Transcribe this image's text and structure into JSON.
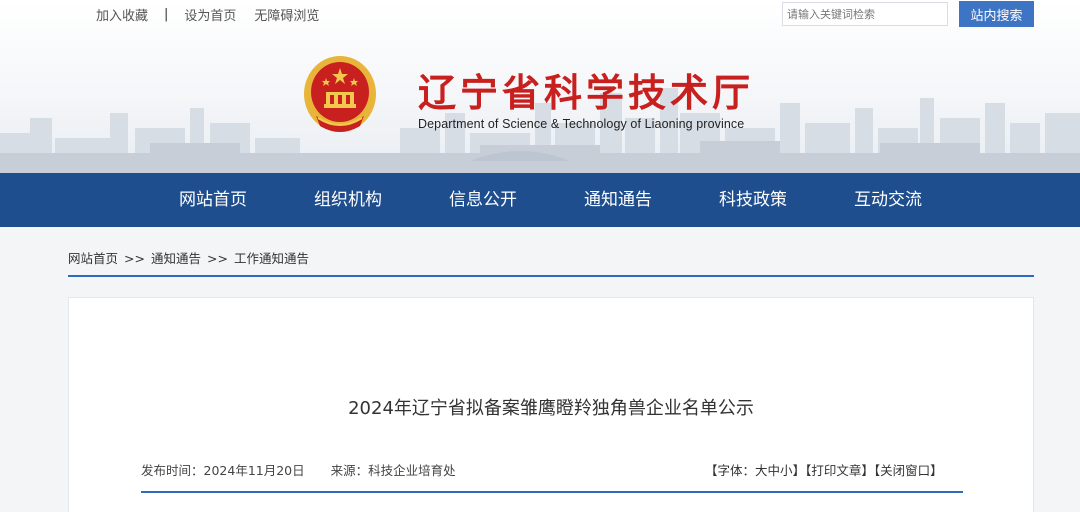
{
  "toolbar": {
    "add_favorite": "加入收藏",
    "separator": "|",
    "set_homepage": "设为首页",
    "accessibility": "无障碍浏览"
  },
  "search": {
    "placeholder": "请输入关键词检索",
    "button_label": "站内搜索"
  },
  "header": {
    "title": "辽宁省科学技术厅",
    "subtitle": "Department of Science & Technology of Liaoning province"
  },
  "nav": {
    "items": [
      {
        "label": "网站首页"
      },
      {
        "label": "组织机构"
      },
      {
        "label": "信息公开"
      },
      {
        "label": "通知通告"
      },
      {
        "label": "科技政策"
      },
      {
        "label": "互动交流"
      }
    ]
  },
  "breadcrumb": {
    "items": [
      "网站首页",
      "通知通告",
      "工作通知通告"
    ],
    "separator": ">>"
  },
  "article": {
    "title": "2024年辽宁省拟备案雏鹰瞪羚独角兽企业名单公示",
    "publish_label": "发布时间：",
    "publish_date": "2024年11月20日",
    "source_label": "来源：",
    "source": "科技企业培育处",
    "font_prefix": "【字体：",
    "font_large": "大",
    "font_medium": "中",
    "font_small": "小",
    "font_suffix": "】",
    "print": "【打印文章】",
    "close": "【关闭窗口】"
  },
  "colors": {
    "nav_bg": "#1f4e8f",
    "title_red": "#c8201e",
    "search_button": "#3e74c4",
    "accent_line": "#2f6ac0"
  }
}
